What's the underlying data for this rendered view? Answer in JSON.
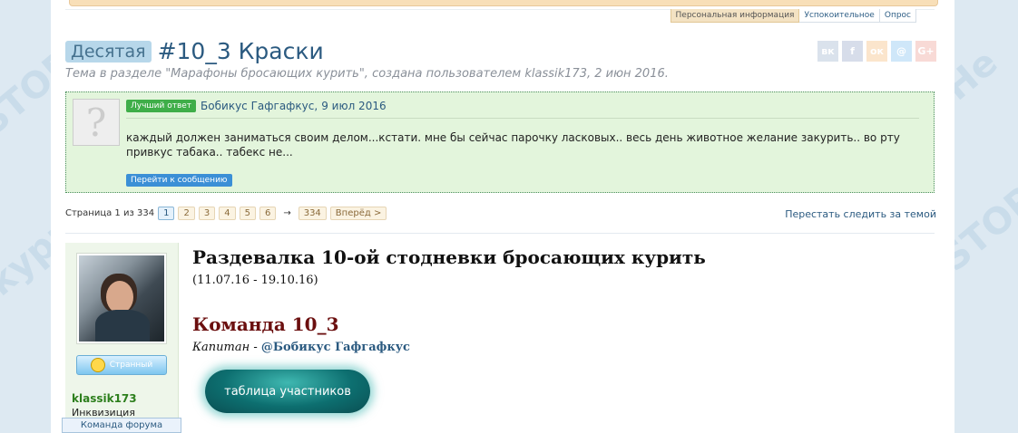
{
  "breadcrumb_tabs": [
    "Персональная информация",
    "Успокоительное",
    "Опрос"
  ],
  "thread": {
    "prefix": "Десятая",
    "title": "#10_3 Краски",
    "meta": "Тема в разделе \"Марафоны бросающих курить\", создана пользователем klassik173, 2 июн 2016."
  },
  "share_buttons": [
    {
      "icon": "vk-icon",
      "glyph": "вк",
      "color": "#4c75a3"
    },
    {
      "icon": "facebook-icon",
      "glyph": "f",
      "color": "#3b5998"
    },
    {
      "icon": "odnoklassniki-icon",
      "glyph": "ок",
      "color": "#ee8208"
    },
    {
      "icon": "moimir-icon",
      "glyph": "@",
      "color": "#168de2"
    },
    {
      "icon": "googleplus-icon",
      "glyph": "G+",
      "color": "#dd4b39"
    }
  ],
  "best_answer": {
    "badge": "Лучший ответ",
    "user": "Бобикус Гафгафкус",
    "date": "9 июл 2016",
    "text": "каждый должен заниматься своим делом...кстати. мне бы сейчас парочку ласковых.. весь день животное желание закурить.. во рту привкус табака.. табекс не...",
    "go_label": "Перейти к сообщению"
  },
  "pagination": {
    "label": "Страница 1 из 334",
    "pages": [
      "1",
      "2",
      "3",
      "4",
      "5",
      "6"
    ],
    "current": "1",
    "gap": "→",
    "last": "334",
    "next": "Вперёд >"
  },
  "unwatch_label": "Перестать следить за темой",
  "author": {
    "title_badge": "Странный",
    "name": "klassik173",
    "group": "Инквизиция"
  },
  "team_forum_tab": "Команда форума",
  "post": {
    "heading": "Раздевалка 10-ой стодневки бросающих курить",
    "dates": "(11.07.16 - 19.10.16)",
    "team": "Команда 10_3",
    "captain_role": "Капитан - ",
    "captain_mention": "@Бобикус Гафгафкус",
    "button": "таблица участников"
  },
  "colors": {
    "accent": "#2b5a80",
    "best_bg": "#e3f5dc",
    "team_heading": "#6b0f0f",
    "button_teal": "#0d6f70"
  }
}
